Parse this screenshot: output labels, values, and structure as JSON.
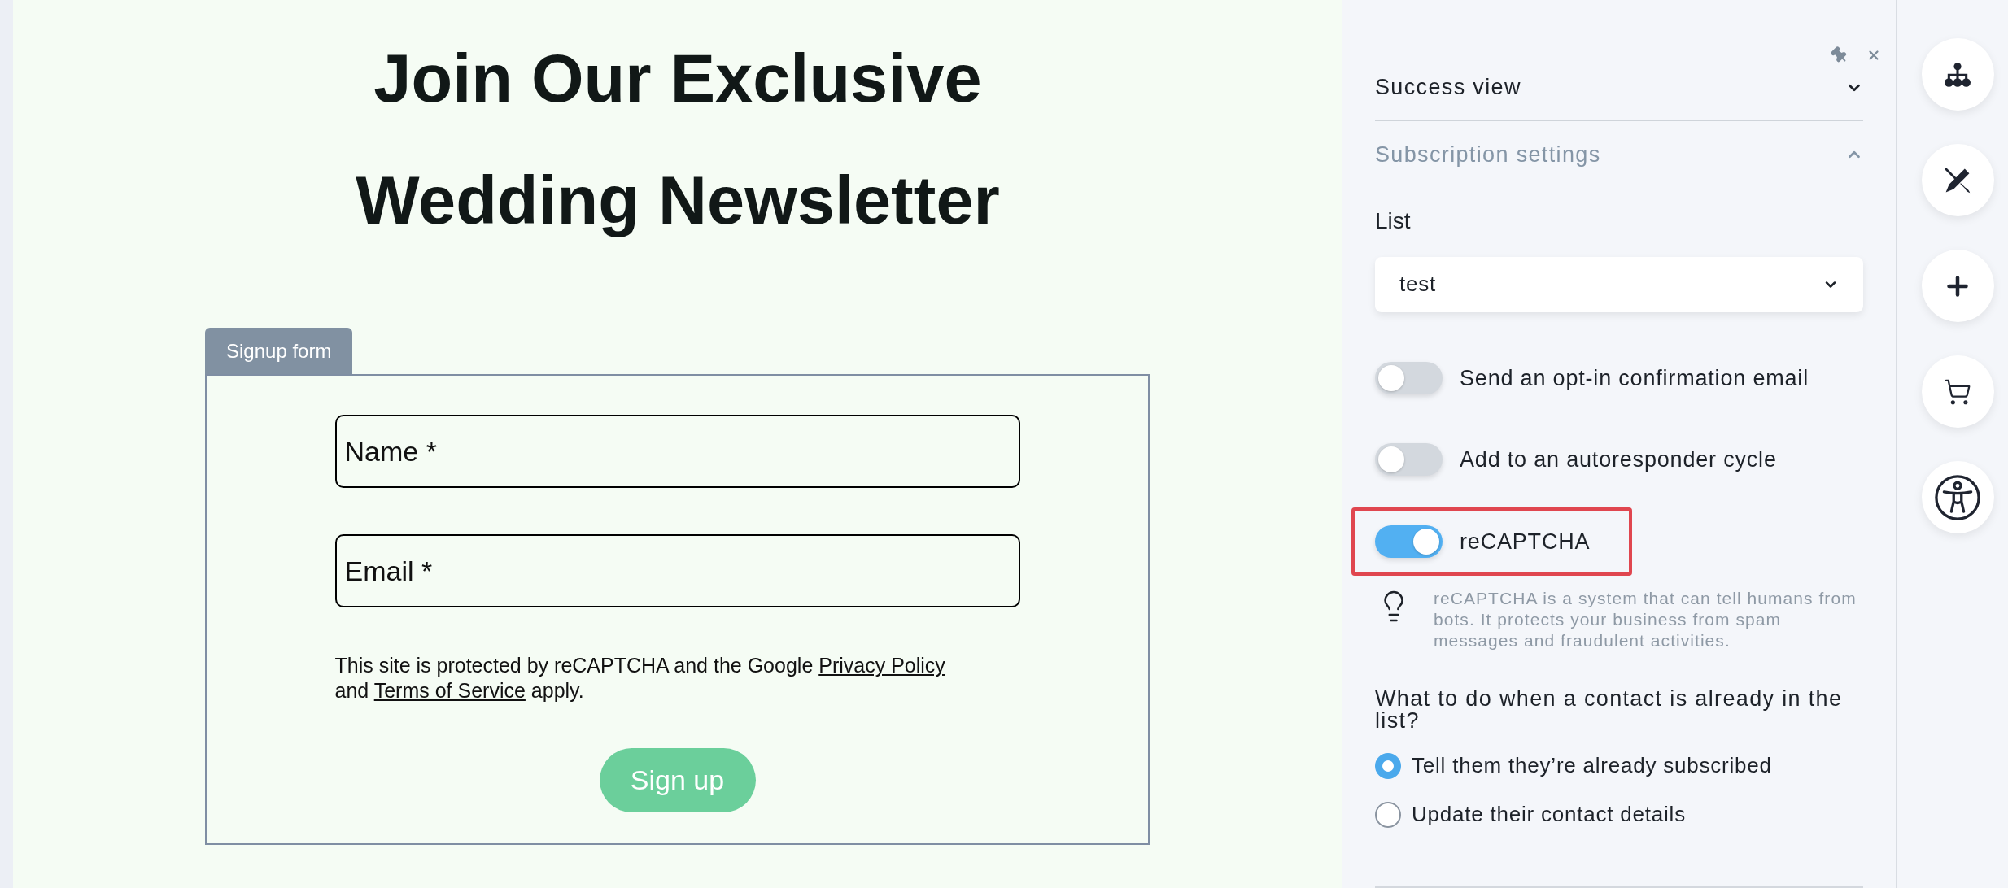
{
  "canvas": {
    "heading": "Join Our Exclusive Wedding Newsletter",
    "form": {
      "tab_label": "Signup form",
      "fields": [
        {
          "placeholder": "Name *"
        },
        {
          "placeholder": "Email *"
        }
      ],
      "notice_lines": [
        [
          {
            "kind": "text",
            "text": "This site is protected by reCAPTCHA and the Google"
          },
          {
            "kind": "link",
            "text": "Privacy Policy"
          }
        ],
        [
          {
            "kind": "text",
            "text": "and"
          },
          {
            "kind": "link",
            "text": "Terms of Service"
          },
          {
            "kind": "text",
            "text": "apply."
          }
        ]
      ],
      "submit_label": "Sign up"
    }
  },
  "panel": {
    "sections": [
      {
        "title": "Success view",
        "expanded": false
      },
      {
        "title": "Subscription settings",
        "expanded": true
      }
    ],
    "list": {
      "label": "List",
      "value": "test"
    },
    "toggles": [
      {
        "label": "Send an opt-in confirmation email",
        "on": false,
        "highlighted": false
      },
      {
        "label": "Add to an autoresponder cycle",
        "on": false,
        "highlighted": false
      },
      {
        "label": "reCAPTCHA",
        "on": true,
        "highlighted": true
      }
    ],
    "hint": "reCAPTCHA is a system that can tell humans from bots. It protects your business from spam messages and fraudulent activities.",
    "question": "What to do when a contact is already in the list?",
    "options": [
      {
        "label": "Tell them they’re already subscribed",
        "selected": true
      },
      {
        "label": "Update their contact details",
        "selected": false
      }
    ]
  }
}
